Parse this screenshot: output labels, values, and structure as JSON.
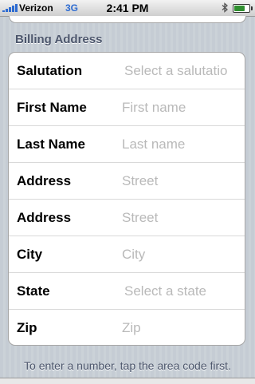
{
  "status_bar": {
    "carrier": "Verizon",
    "network": "3G",
    "time": "2:41 PM",
    "signal_bars": 5,
    "battery_level": 0.8,
    "icons": [
      "signal-icon",
      "bluetooth-icon",
      "battery-icon"
    ]
  },
  "section": {
    "header": "Billing Address"
  },
  "rows": [
    {
      "label": "Salutation",
      "placeholder": "Select a salutatio",
      "kind": "select"
    },
    {
      "label": "First Name",
      "placeholder": "First name",
      "kind": "text"
    },
    {
      "label": "Last Name",
      "placeholder": "Last name",
      "kind": "text"
    },
    {
      "label": "Address",
      "placeholder": "Street",
      "kind": "text"
    },
    {
      "label": "Address",
      "placeholder": "Street",
      "kind": "text"
    },
    {
      "label": "City",
      "placeholder": "City",
      "kind": "text"
    },
    {
      "label": "State",
      "placeholder": "Select a state",
      "kind": "select"
    },
    {
      "label": "Zip",
      "placeholder": "Zip",
      "kind": "text"
    }
  ],
  "footer": {
    "note": "To enter a number, tap the area code first."
  },
  "colors": {
    "background": "#c5ccd4",
    "section_header": "#4c566c",
    "placeholder": "#b9b9b9",
    "network_accent": "#2d6bd1"
  }
}
